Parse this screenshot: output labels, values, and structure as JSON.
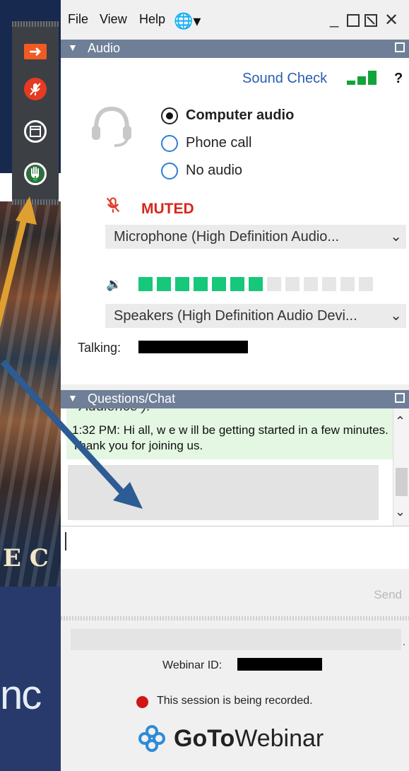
{
  "menubar": {
    "file": "File",
    "view": "View",
    "help": "Help"
  },
  "audio": {
    "section_title": "Audio",
    "sound_check": "Sound Check",
    "help_mark": "?",
    "options": [
      "Computer audio",
      "Phone call",
      "No audio"
    ],
    "selected_option": "Computer audio",
    "muted_label": "MUTED",
    "microphone": "Microphone (High Definition Audio...",
    "speakers": "Speakers (High Definition Audio Devi...",
    "talking_label": "Talking:",
    "speaker_level_segments_lit": 7,
    "speaker_level_segments_total": 13
  },
  "chat": {
    "section_title": "Questions/Chat",
    "clipped_line": "Audience ).",
    "message": "1:32 PM: Hi all, w e w ill be getting started in a few  minutes. Thank you for joining us.",
    "send_label": "Send"
  },
  "footer": {
    "webinar_id_label": "Webinar ID:",
    "recording_notice": "This session is being recorded.",
    "brand_bold": "GoTo",
    "brand_rest": "Webinar"
  },
  "background": {
    "photo_caption": "E C",
    "big_text": "nc"
  },
  "colors": {
    "accent_blue": "#2a5db0",
    "muted_red": "#d8261c",
    "level_green": "#12a33a",
    "chat_green": "#e3f7e2",
    "arrow_gold": "#e0a030",
    "arrow_blue": "#2d5b93"
  }
}
